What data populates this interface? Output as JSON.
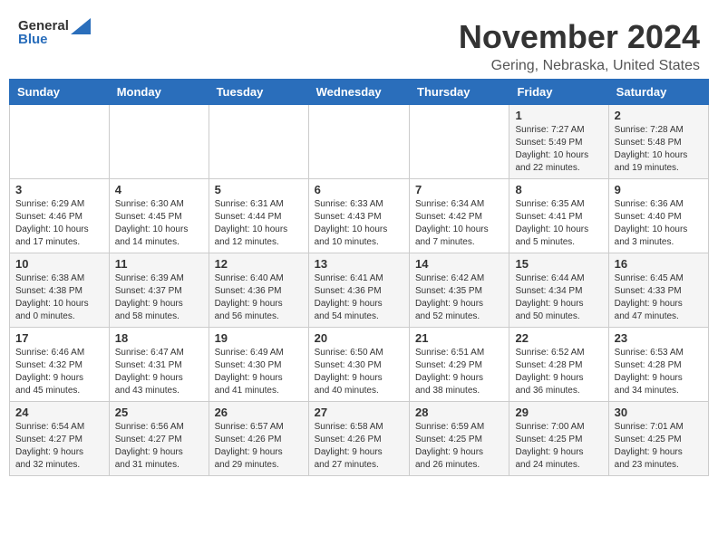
{
  "header": {
    "logo_general": "General",
    "logo_blue": "Blue",
    "title": "November 2024",
    "location": "Gering, Nebraska, United States"
  },
  "weekdays": [
    "Sunday",
    "Monday",
    "Tuesday",
    "Wednesday",
    "Thursday",
    "Friday",
    "Saturday"
  ],
  "weeks": [
    [
      {
        "day": "",
        "info": ""
      },
      {
        "day": "",
        "info": ""
      },
      {
        "day": "",
        "info": ""
      },
      {
        "day": "",
        "info": ""
      },
      {
        "day": "",
        "info": ""
      },
      {
        "day": "1",
        "info": "Sunrise: 7:27 AM\nSunset: 5:49 PM\nDaylight: 10 hours\nand 22 minutes."
      },
      {
        "day": "2",
        "info": "Sunrise: 7:28 AM\nSunset: 5:48 PM\nDaylight: 10 hours\nand 19 minutes."
      }
    ],
    [
      {
        "day": "3",
        "info": "Sunrise: 6:29 AM\nSunset: 4:46 PM\nDaylight: 10 hours\nand 17 minutes."
      },
      {
        "day": "4",
        "info": "Sunrise: 6:30 AM\nSunset: 4:45 PM\nDaylight: 10 hours\nand 14 minutes."
      },
      {
        "day": "5",
        "info": "Sunrise: 6:31 AM\nSunset: 4:44 PM\nDaylight: 10 hours\nand 12 minutes."
      },
      {
        "day": "6",
        "info": "Sunrise: 6:33 AM\nSunset: 4:43 PM\nDaylight: 10 hours\nand 10 minutes."
      },
      {
        "day": "7",
        "info": "Sunrise: 6:34 AM\nSunset: 4:42 PM\nDaylight: 10 hours\nand 7 minutes."
      },
      {
        "day": "8",
        "info": "Sunrise: 6:35 AM\nSunset: 4:41 PM\nDaylight: 10 hours\nand 5 minutes."
      },
      {
        "day": "9",
        "info": "Sunrise: 6:36 AM\nSunset: 4:40 PM\nDaylight: 10 hours\nand 3 minutes."
      }
    ],
    [
      {
        "day": "10",
        "info": "Sunrise: 6:38 AM\nSunset: 4:38 PM\nDaylight: 10 hours\nand 0 minutes."
      },
      {
        "day": "11",
        "info": "Sunrise: 6:39 AM\nSunset: 4:37 PM\nDaylight: 9 hours\nand 58 minutes."
      },
      {
        "day": "12",
        "info": "Sunrise: 6:40 AM\nSunset: 4:36 PM\nDaylight: 9 hours\nand 56 minutes."
      },
      {
        "day": "13",
        "info": "Sunrise: 6:41 AM\nSunset: 4:36 PM\nDaylight: 9 hours\nand 54 minutes."
      },
      {
        "day": "14",
        "info": "Sunrise: 6:42 AM\nSunset: 4:35 PM\nDaylight: 9 hours\nand 52 minutes."
      },
      {
        "day": "15",
        "info": "Sunrise: 6:44 AM\nSunset: 4:34 PM\nDaylight: 9 hours\nand 50 minutes."
      },
      {
        "day": "16",
        "info": "Sunrise: 6:45 AM\nSunset: 4:33 PM\nDaylight: 9 hours\nand 47 minutes."
      }
    ],
    [
      {
        "day": "17",
        "info": "Sunrise: 6:46 AM\nSunset: 4:32 PM\nDaylight: 9 hours\nand 45 minutes."
      },
      {
        "day": "18",
        "info": "Sunrise: 6:47 AM\nSunset: 4:31 PM\nDaylight: 9 hours\nand 43 minutes."
      },
      {
        "day": "19",
        "info": "Sunrise: 6:49 AM\nSunset: 4:30 PM\nDaylight: 9 hours\nand 41 minutes."
      },
      {
        "day": "20",
        "info": "Sunrise: 6:50 AM\nSunset: 4:30 PM\nDaylight: 9 hours\nand 40 minutes."
      },
      {
        "day": "21",
        "info": "Sunrise: 6:51 AM\nSunset: 4:29 PM\nDaylight: 9 hours\nand 38 minutes."
      },
      {
        "day": "22",
        "info": "Sunrise: 6:52 AM\nSunset: 4:28 PM\nDaylight: 9 hours\nand 36 minutes."
      },
      {
        "day": "23",
        "info": "Sunrise: 6:53 AM\nSunset: 4:28 PM\nDaylight: 9 hours\nand 34 minutes."
      }
    ],
    [
      {
        "day": "24",
        "info": "Sunrise: 6:54 AM\nSunset: 4:27 PM\nDaylight: 9 hours\nand 32 minutes."
      },
      {
        "day": "25",
        "info": "Sunrise: 6:56 AM\nSunset: 4:27 PM\nDaylight: 9 hours\nand 31 minutes."
      },
      {
        "day": "26",
        "info": "Sunrise: 6:57 AM\nSunset: 4:26 PM\nDaylight: 9 hours\nand 29 minutes."
      },
      {
        "day": "27",
        "info": "Sunrise: 6:58 AM\nSunset: 4:26 PM\nDaylight: 9 hours\nand 27 minutes."
      },
      {
        "day": "28",
        "info": "Sunrise: 6:59 AM\nSunset: 4:25 PM\nDaylight: 9 hours\nand 26 minutes."
      },
      {
        "day": "29",
        "info": "Sunrise: 7:00 AM\nSunset: 4:25 PM\nDaylight: 9 hours\nand 24 minutes."
      },
      {
        "day": "30",
        "info": "Sunrise: 7:01 AM\nSunset: 4:25 PM\nDaylight: 9 hours\nand 23 minutes."
      }
    ]
  ]
}
